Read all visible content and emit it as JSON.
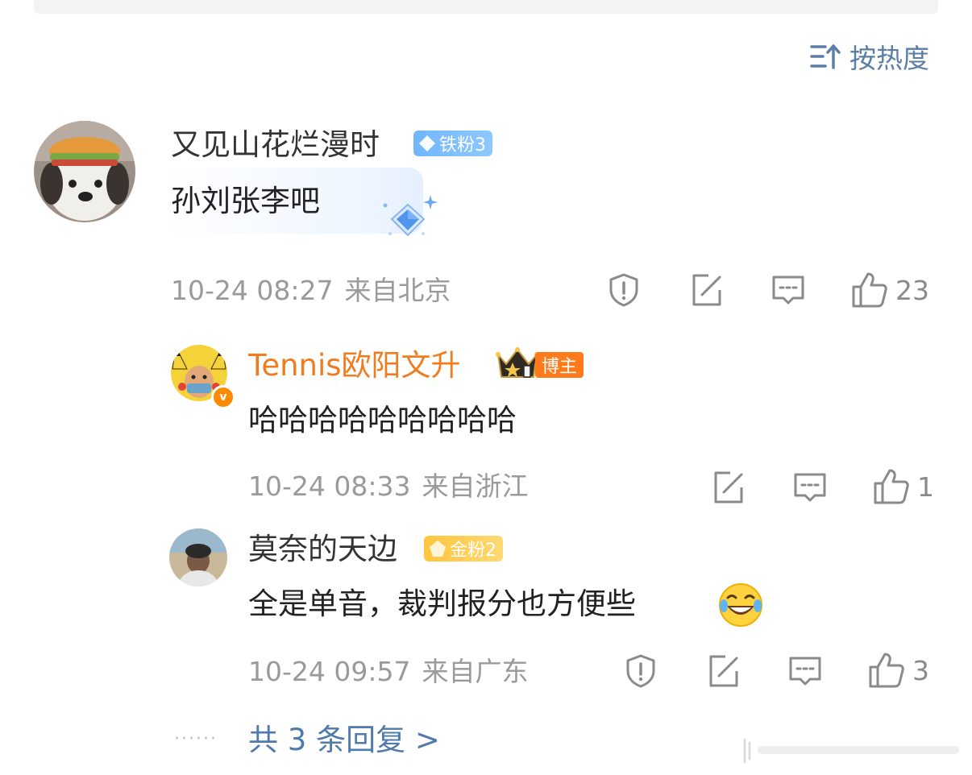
{
  "sort": {
    "icon": "sort-icon",
    "label": "按热度"
  },
  "comments": [
    {
      "avatar_icon": "dog-with-hat-avatar",
      "name": "又见山花烂漫时",
      "badge": "铁粉3",
      "content": "孙刘张李吧",
      "time": "10-24 08:27",
      "location": "来自北京",
      "likes": "23"
    },
    {
      "avatar_icon": "pikachu-avatar",
      "name": "Tennis欧阳文升",
      "badge": "博主",
      "verified": "v",
      "content": "哈哈哈哈哈哈哈哈哈",
      "time": "10-24 08:33",
      "location": "来自浙江",
      "likes": "1"
    },
    {
      "avatar_icon": "person-photo-avatar",
      "name": "莫奈的天边",
      "badge": "金粉2",
      "content": "全是单音，裁判报分也方便些",
      "emoji": "😂",
      "time": "10-24 09:57",
      "location": "来自广东",
      "likes": "3"
    }
  ],
  "more_replies": {
    "dots": "······",
    "label": "共 3 条回复 >"
  },
  "colors": {
    "link": "#4f7aab",
    "meta": "#9a9a9a",
    "blogger": "#f07c20"
  }
}
